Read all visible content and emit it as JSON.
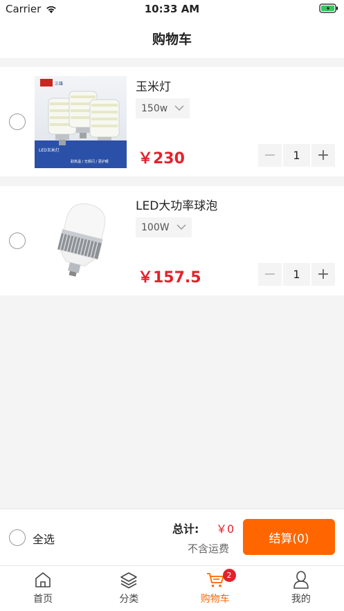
{
  "status_bar": {
    "carrier": "Carrier",
    "time": "10:33 AM"
  },
  "nav": {
    "title": "购物车"
  },
  "cart_items": [
    {
      "name": "玉米灯",
      "spec": "150w",
      "price": "￥230",
      "quantity": "1"
    },
    {
      "name": "LED大功率球泡",
      "spec": "100W",
      "price": "￥157.5",
      "quantity": "1"
    }
  ],
  "thumb1_text": {
    "brand": "三雄",
    "line1": "LED玉米灯",
    "line2": "耐高温 / 无频闪 / 更护眼"
  },
  "stepper": {
    "minus": "−",
    "plus": "+"
  },
  "footer": {
    "select_all": "全选",
    "total_label": "总计:",
    "total_value": "￥0",
    "shipping_note": "不含运费",
    "checkout": "结算(0)"
  },
  "tabbar": {
    "tabs": [
      {
        "label": "首页",
        "icon": "home-icon"
      },
      {
        "label": "分类",
        "icon": "layers-icon"
      },
      {
        "label": "购物车",
        "icon": "cart-icon",
        "badge": "2"
      },
      {
        "label": "我的",
        "icon": "user-icon"
      }
    ]
  },
  "colors": {
    "accent": "#ff6600",
    "price": "#e4212b"
  }
}
